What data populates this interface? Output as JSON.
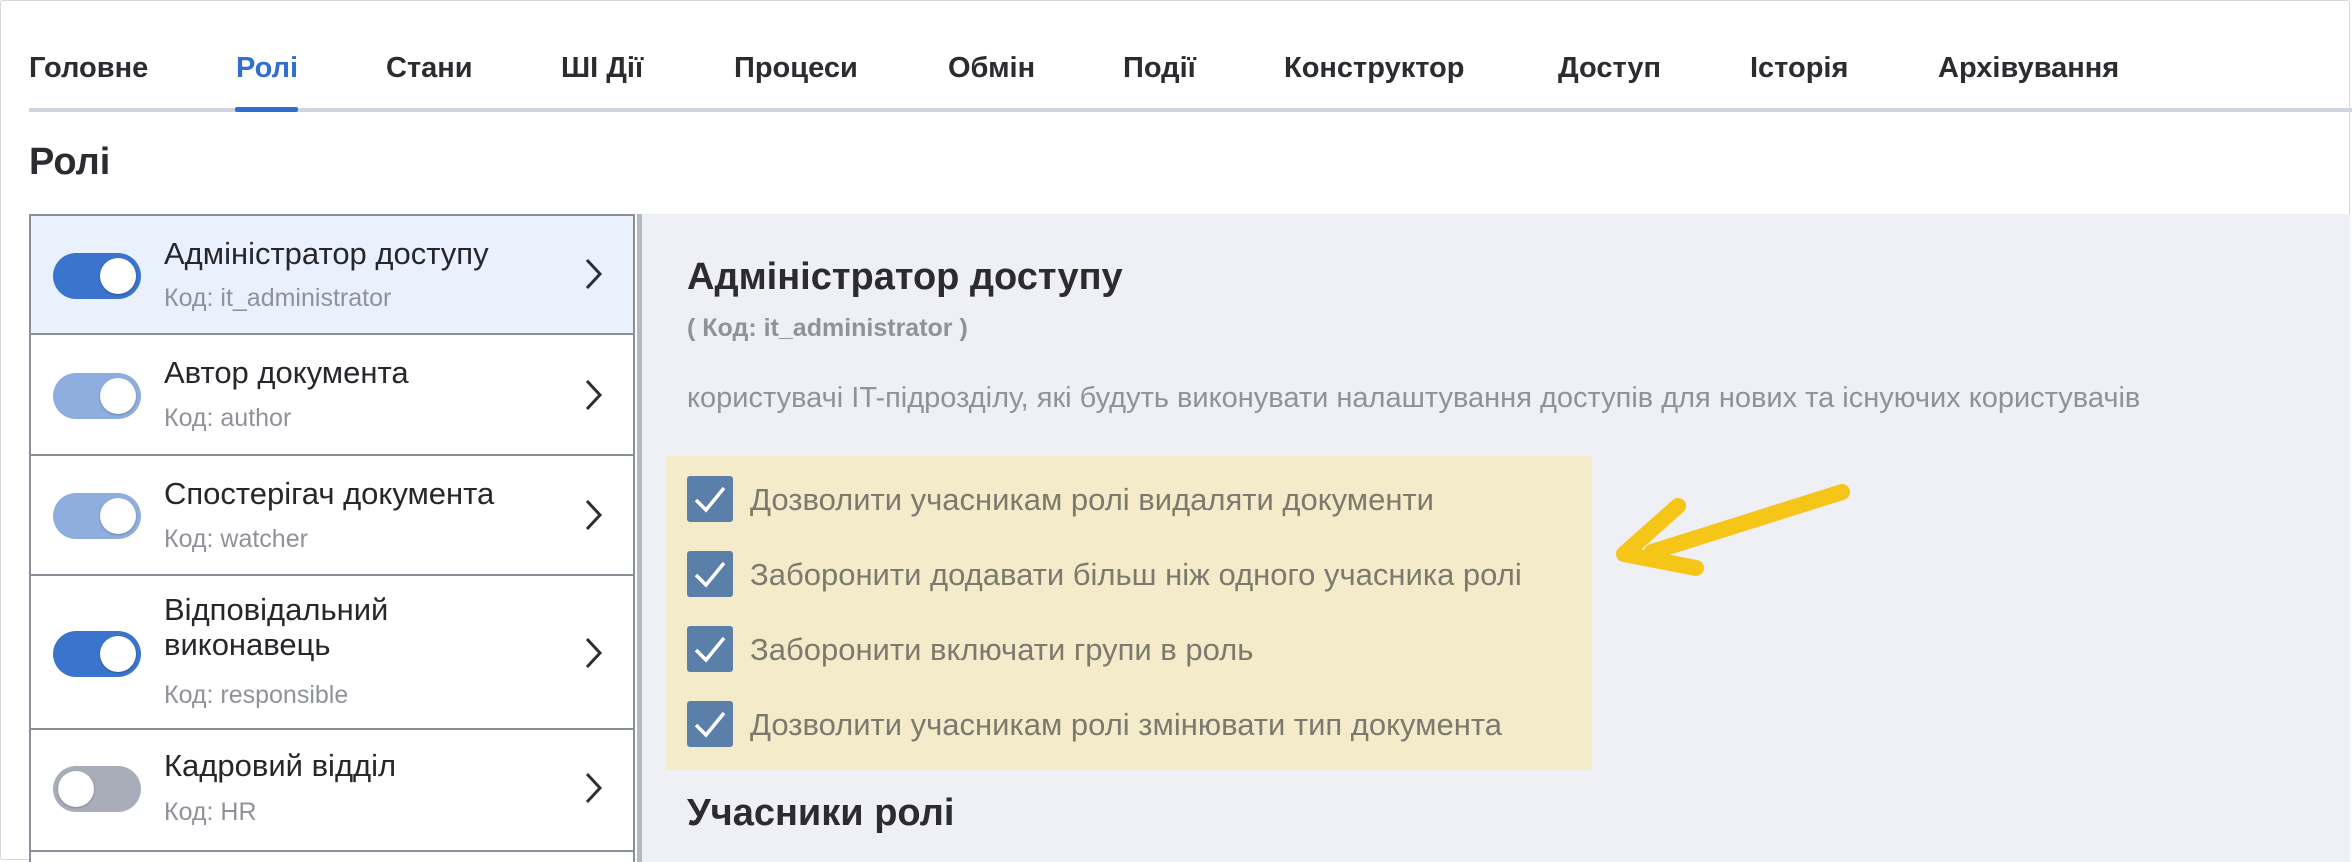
{
  "tabs": [
    {
      "label": "Головне",
      "active": false
    },
    {
      "label": "Ролі",
      "active": true
    },
    {
      "label": "Стани",
      "active": false
    },
    {
      "label": "ШІ Дії",
      "active": false
    },
    {
      "label": "Процеси",
      "active": false
    },
    {
      "label": "Обмін",
      "active": false
    },
    {
      "label": "Події",
      "active": false
    },
    {
      "label": "Конструктор",
      "active": false
    },
    {
      "label": "Доступ",
      "active": false
    },
    {
      "label": "Історія",
      "active": false
    },
    {
      "label": "Архівування",
      "active": false
    }
  ],
  "page": {
    "title": "Ролі"
  },
  "roles": [
    {
      "name": "Адміністратор доступу",
      "code": "Код: it_administrator",
      "toggle": "on",
      "selected": true
    },
    {
      "name": "Автор документа",
      "code": "Код: author",
      "toggle": "on-disabled",
      "selected": false
    },
    {
      "name": "Спостерігач документа",
      "code": "Код: watcher",
      "toggle": "on-disabled",
      "selected": false
    },
    {
      "name_line1": "Відповідальний",
      "name_line2": "виконавець",
      "code": "Код: responsible",
      "toggle": "on",
      "selected": false
    },
    {
      "name": "Кадровий відділ",
      "code": "Код: HR",
      "toggle": "off",
      "selected": false
    }
  ],
  "detail": {
    "title": "Адміністратор доступу",
    "code": "( Код: it_administrator )",
    "description": "користувачі IT-підрозділу, які будуть виконувати налаштування доступів для нових та існуючих користувачів",
    "options": [
      {
        "label": "Дозволити учасникам ролі видаляти документи",
        "checked": true
      },
      {
        "label": "Заборонити додавати більш ніж одного учасника ролі",
        "checked": true
      },
      {
        "label": "Заборонити включати групи в роль",
        "checked": true
      },
      {
        "label": "Дозволити учасникам ролі змінювати тип документа",
        "checked": true
      }
    ],
    "members_title": "Учасники ролі"
  },
  "colors": {
    "accent": "#2f6fcf",
    "toggle_on": "#3a74cc",
    "toggle_on_disabled": "#8eaee0",
    "toggle_off": "#a8adb9",
    "highlight_bg": "#f3ebca",
    "checkbox": "#5a7fa8",
    "annotation_arrow": "#f5c518"
  },
  "icons": {
    "chevron": "chevron-right-icon",
    "checkbox": "checkmark-icon",
    "annotation": "arrow-left-icon"
  }
}
